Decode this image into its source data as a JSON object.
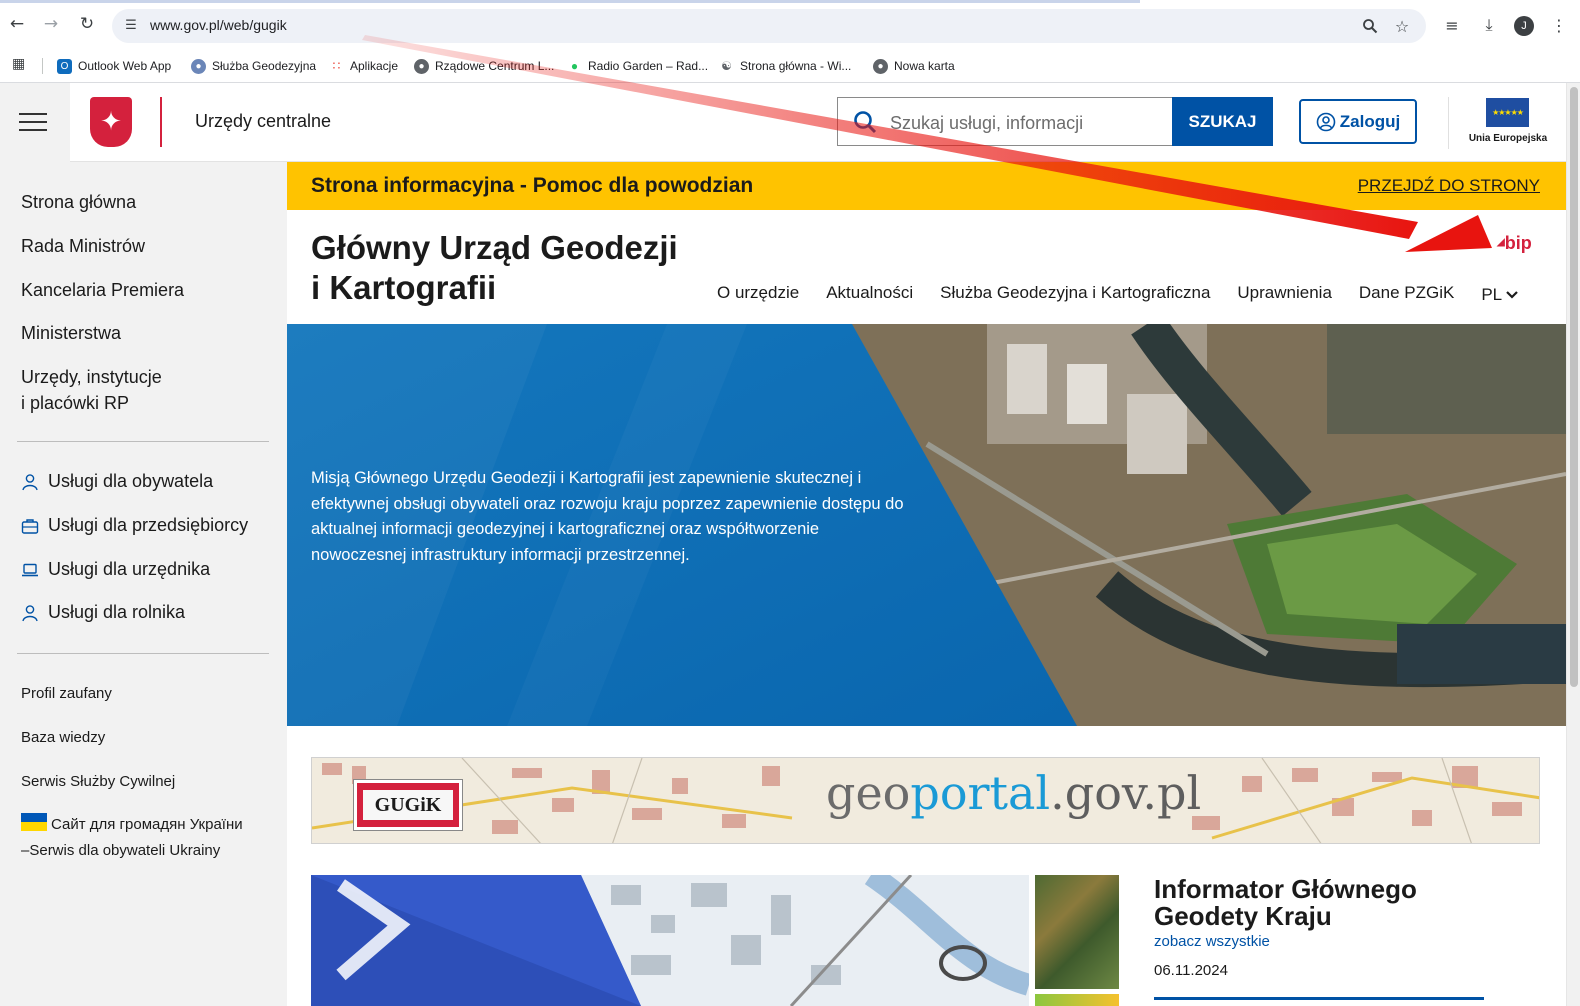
{
  "browser": {
    "url": "www.gov.pl/web/gugik",
    "avatar_letter": "J",
    "bookmarks": [
      {
        "label": "Outlook Web App",
        "icon": "outlook-icon"
      },
      {
        "label": "Służba Geodezyjna",
        "icon": "globe-icon"
      },
      {
        "label": "Aplikacje",
        "icon": "apps-grid-icon"
      },
      {
        "label": "Rządowe Centrum L...",
        "icon": "globe-icon"
      },
      {
        "label": "Radio Garden – Rad...",
        "icon": "green-dot-icon"
      },
      {
        "label": "Strona główna - Wi...",
        "icon": "binoculars-icon"
      },
      {
        "label": "Nowa karta",
        "icon": "globe-icon"
      }
    ]
  },
  "header": {
    "title": "Urzędy centralne",
    "search_placeholder": "Szukaj usługi, informacji",
    "search_button": "SZUKAJ",
    "login_button": "Zaloguj",
    "eu_label": "Unia Europejska"
  },
  "sidebar": {
    "main_items": [
      "Strona główna",
      "Rada Ministrów",
      "Kancelaria Premiera",
      "Ministerstwa"
    ],
    "offices_line1": "Urzędy, instytucje",
    "offices_line2": "i placówki RP",
    "services": [
      {
        "label": "Usługi dla obywatela",
        "icon": "person-icon"
      },
      {
        "label": "Usługi dla przedsiębiorcy",
        "icon": "briefcase-icon"
      },
      {
        "label": "Usługi dla urzędnika",
        "icon": "laptop-icon"
      },
      {
        "label": "Usługi dla rolnika",
        "icon": "person-icon"
      }
    ],
    "small_items": [
      "Profil zaufany",
      "Baza wiedzy",
      "Serwis Służby Cywilnej"
    ],
    "ukraine_line1": "Сайт для громадян України",
    "ukraine_line2": "–Serwis dla obywateli Ukrainy"
  },
  "alert": {
    "text": "Strona informacyjna - Pomoc dla powodzian",
    "link": "PRZEJDŹ DO STRONY"
  },
  "office": {
    "title": "Główny Urząd Geodezji i Kartografii",
    "bip": "bip",
    "nav": [
      "O urzędzie",
      "Aktualności",
      "Służba Geodezyjna i Kartograficzna",
      "Uprawnienia",
      "Dane PZGiK"
    ],
    "lang": "PL"
  },
  "hero": {
    "text": "Misją Głównego Urzędu Geodezji i Kartografii jest zapewnienie skutecznej i efektywnej obsługi obywateli oraz rozwoju kraju poprzez zapewnienie dostępu do aktualnej informacji geodezyjnej i kartograficznej oraz współtworzenie nowoczesnej infrastruktury informacji przestrzennej."
  },
  "banner": {
    "badge": "GUGiK",
    "geo_a": "geo",
    "geo_b": "portal",
    "geo_c": ".gov.pl"
  },
  "news": {
    "title": "Informator Głównego Geodety Kraju",
    "see_all": "zobacz wszystkie",
    "date": "06.11.2024"
  },
  "colors": {
    "gov_blue": "#0052a5",
    "alert_yellow": "#ffc300",
    "emblem_red": "#d4213d",
    "annotation_arrow": "#e8140f"
  }
}
